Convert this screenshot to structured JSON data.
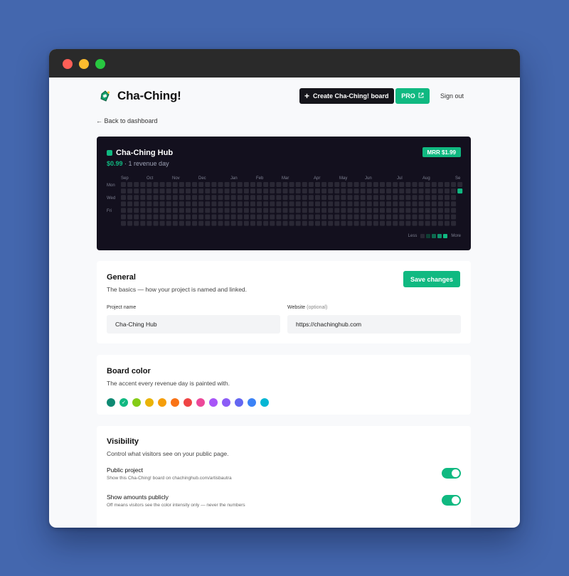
{
  "header": {
    "app_name": "Cha-Ching!",
    "create_label": "Create Cha-Ching! board",
    "pro_label": "PRO",
    "signout_label": "Sign out",
    "back_label": "← Back to dashboard"
  },
  "hub": {
    "name": "Cha-Ching Hub",
    "amount": "$0.99",
    "summary": " · 1 revenue day",
    "mrr_badge": "MRR $1.99",
    "months": [
      "Sep",
      "Oct",
      "Nov",
      "Dec",
      "Jan",
      "Feb",
      "Mar",
      "Apr",
      "May",
      "Jun",
      "Jul",
      "Aug",
      "Se"
    ],
    "days": [
      "Mon",
      "Wed",
      "Fri"
    ],
    "legend_less": "Less",
    "legend_more": "More",
    "legend_colors": [
      "#2a2835",
      "#0f3f34",
      "#0e6a50",
      "#0e936c",
      "#10b981"
    ],
    "accent": "#10b981",
    "empty_cell_color": "#2a2835",
    "week_count": 53,
    "active_day": {
      "week": 52,
      "weekday": 1,
      "level": 4
    }
  },
  "general": {
    "title": "General",
    "desc": "The basics — how your project is named and linked.",
    "save_label": "Save changes",
    "project_name_label": "Project name",
    "project_name_value": "Cha-Ching Hub",
    "website_label": "Website",
    "website_optional": "(optional)",
    "website_value": "https://chachinghub.com"
  },
  "board_color": {
    "title": "Board color",
    "desc": "The accent every revenue day is painted with.",
    "selected_index": 1,
    "colors": [
      "#0f8a73",
      "#10b981",
      "#84cc16",
      "#eab308",
      "#f59e0b",
      "#f97316",
      "#ef4444",
      "#ec4899",
      "#a855f7",
      "#8b5cf6",
      "#6366f1",
      "#3b82f6",
      "#06b6d4"
    ]
  },
  "visibility": {
    "title": "Visibility",
    "desc": "Control what visitors see on your public page.",
    "items": [
      {
        "title": "Public project",
        "sub": "Show this Cha-Ching! board on chachinghub.com/artisbautra",
        "on": true
      },
      {
        "title": "Show amounts publicly",
        "sub": "Off means visitors see the color intensity only — never the numbers",
        "on": true
      }
    ]
  }
}
